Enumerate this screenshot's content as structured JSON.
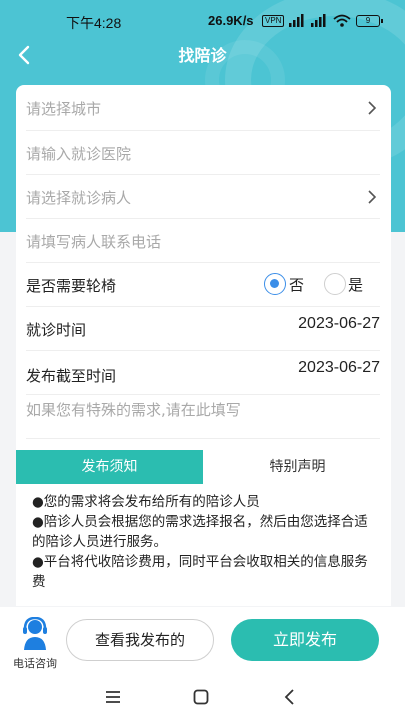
{
  "status_bar": {
    "time": "下午4:28",
    "network_speed": "26.9K/s",
    "vpn": "VPN",
    "battery": "9"
  },
  "header": {
    "title": "找陪诊",
    "back_icon": "chevron-left-icon"
  },
  "form": {
    "city_placeholder": "请选择城市",
    "hospital_placeholder": "请输入就诊医院",
    "patient_placeholder": "请选择就诊病人",
    "phone_placeholder": "请填写病人联系电话",
    "wheelchair": {
      "label": "是否需要轮椅",
      "options": [
        {
          "label": "否",
          "selected": true
        },
        {
          "label": "是",
          "selected": false
        }
      ]
    },
    "visit_time": {
      "label": "就诊时间",
      "value": "2023-06-27"
    },
    "deadline": {
      "label": "发布截至时间",
      "value": "2023-06-27"
    },
    "special_needs_placeholder": "如果您有特殊的需求,请在此填写"
  },
  "tabs": [
    {
      "label": "发布须知",
      "active": true
    },
    {
      "label": "特别声明",
      "active": false
    }
  ],
  "notice": {
    "lines": [
      "●您的需求将会发布给所有的陪诊人员",
      "●陪诊人员会根据您的需求选择报名，然后由您选择合适的陪诊人员进行服务。",
      "●平台将代收陪诊费用，同时平台会收取相关的信息服务费"
    ]
  },
  "footer": {
    "consult_label": "电话咨询",
    "consult_icon": "headset-icon",
    "view_button": "查看我发布的",
    "publish_button": "立即发布"
  },
  "colors": {
    "header_bg": "#4cc4d3",
    "accent": "#2bbdb0",
    "radio_blue": "#3b8ee8"
  }
}
